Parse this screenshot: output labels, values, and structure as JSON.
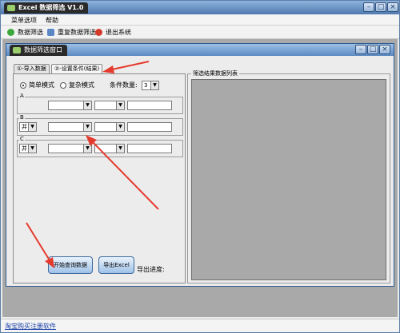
{
  "window": {
    "title": "Excel 数据筛选 V1.0"
  },
  "menu": {
    "items": [
      "菜单选项",
      "帮助"
    ]
  },
  "toolbar": {
    "filter": "数据筛选",
    "repeat": "重复数据筛选",
    "exit": "退出系统"
  },
  "child": {
    "title": "数据筛选窗口",
    "tabs": [
      "①-导入数据",
      "②-设置条件(结果)"
    ],
    "mode": {
      "simple": "简单模式",
      "complex": "复杂模式",
      "selected": "simple"
    },
    "condition_count_label": "条件数量:",
    "condition_count": "3",
    "groups": [
      {
        "legend": "A",
        "logic": ""
      },
      {
        "legend": "B",
        "logic": "并"
      },
      {
        "legend": "C",
        "logic": "并"
      }
    ],
    "results_label": "筛选结果数据列表",
    "buttons": {
      "query": "开始查询数据",
      "export": "导出Excel"
    },
    "progress_label": "导出进度:"
  },
  "status": {
    "link": "淘宝购买注册软件"
  },
  "colors": {
    "arrow": "#e53a2e",
    "accent": "#4f79b0"
  }
}
